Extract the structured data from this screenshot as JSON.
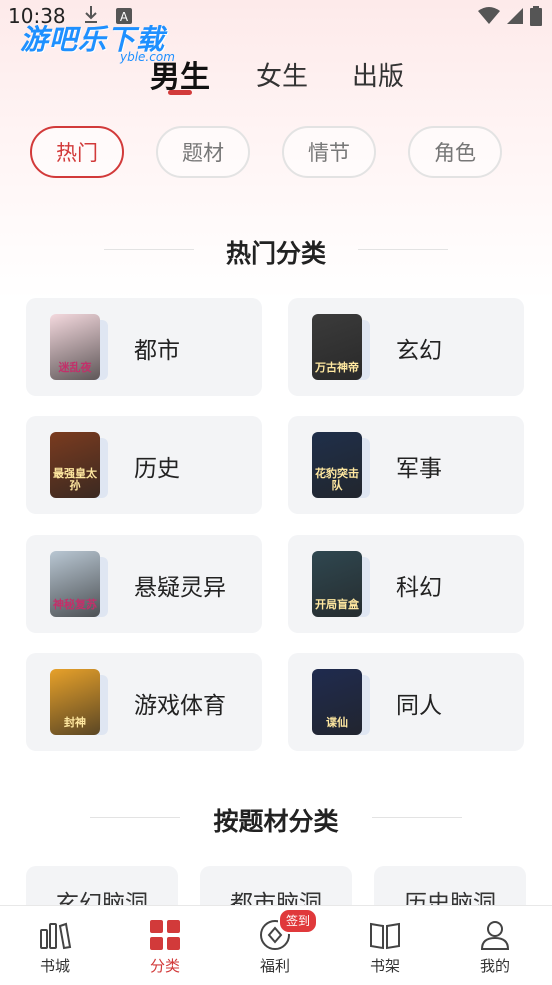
{
  "status_bar": {
    "time": "10:38"
  },
  "watermark": {
    "text": "游吧乐下载",
    "sub": "yble.com"
  },
  "gender_tabs": [
    {
      "label": "男生",
      "active": true
    },
    {
      "label": "女生",
      "active": false
    },
    {
      "label": "出版",
      "active": false
    }
  ],
  "filters": [
    {
      "label": "热门",
      "active": true
    },
    {
      "label": "题材",
      "active": false
    },
    {
      "label": "情节",
      "active": false
    },
    {
      "label": "角色",
      "active": false
    }
  ],
  "hot_section": {
    "title": "热门分类",
    "categories": [
      {
        "label": "都市",
        "cover_text": "迷乱夜",
        "cover_color": "#f4d9de"
      },
      {
        "label": "玄幻",
        "cover_text": "万古神帝",
        "cover_color": "#3b3b3b"
      },
      {
        "label": "历史",
        "cover_text": "最强皇太孙",
        "cover_color": "#7a3b1f"
      },
      {
        "label": "军事",
        "cover_text": "花豹突击队",
        "cover_color": "#1f2f4a"
      },
      {
        "label": "悬疑灵异",
        "cover_text": "神秘复苏",
        "cover_color": "#b9c7d3"
      },
      {
        "label": "科幻",
        "cover_text": "开局盲盒",
        "cover_color": "#2f4750"
      },
      {
        "label": "游戏体育",
        "cover_text": "封神",
        "cover_color": "#e7a12a"
      },
      {
        "label": "同人",
        "cover_text": "谍仙",
        "cover_color": "#1f2b4f"
      }
    ]
  },
  "theme_section": {
    "title": "按题材分类",
    "items": [
      "玄幻脑洞",
      "都市脑洞",
      "历史脑洞"
    ]
  },
  "bottom_nav": [
    {
      "label": "书城",
      "icon": "bookstore-icon",
      "active": false
    },
    {
      "label": "分类",
      "icon": "category-grid-icon",
      "active": true
    },
    {
      "label": "福利",
      "icon": "welfare-icon",
      "active": false,
      "badge": "签到"
    },
    {
      "label": "书架",
      "icon": "bookshelf-icon",
      "active": false
    },
    {
      "label": "我的",
      "icon": "profile-icon",
      "active": false
    }
  ],
  "colors": {
    "accent": "#d23a3a",
    "card_bg": "#f3f4f6"
  }
}
